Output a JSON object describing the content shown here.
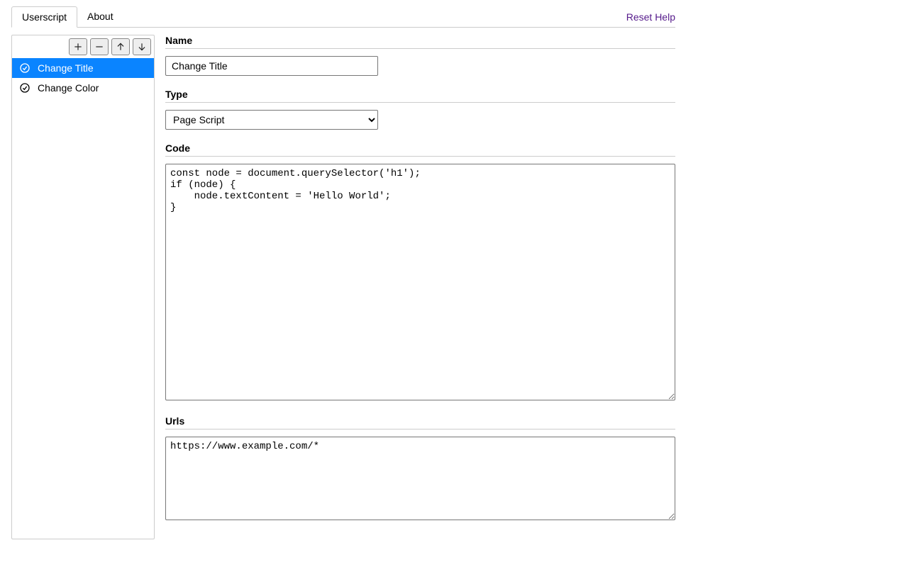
{
  "tabs": {
    "items": [
      {
        "label": "Userscript",
        "active": true
      },
      {
        "label": "About",
        "active": false
      }
    ],
    "reset_help": "Reset Help"
  },
  "toolbar": {
    "add": "+",
    "remove": "−",
    "up": "↑",
    "down": "↓"
  },
  "sidebar": {
    "items": [
      {
        "label": "Change Title",
        "selected": true
      },
      {
        "label": "Change Color",
        "selected": false
      }
    ]
  },
  "form": {
    "name_label": "Name",
    "name_value": "Change Title",
    "type_label": "Type",
    "type_value": "Page Script",
    "type_options": [
      "Page Script"
    ],
    "code_label": "Code",
    "code_value": "const node = document.querySelector('h1');\nif (node) {\n    node.textContent = 'Hello World';\n}",
    "urls_label": "Urls",
    "urls_value": "https://www.example.com/*"
  }
}
